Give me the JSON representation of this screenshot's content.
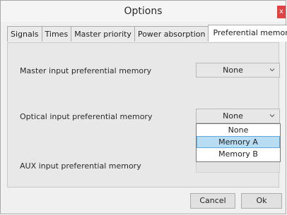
{
  "window": {
    "title": "Options",
    "close_glyph": "x"
  },
  "tabs": [
    {
      "label": "Signals",
      "active": false
    },
    {
      "label": "Times",
      "active": false
    },
    {
      "label": "Master priority",
      "active": false
    },
    {
      "label": "Power absorption",
      "active": false
    },
    {
      "label": "Preferential memory",
      "active": true
    }
  ],
  "settings": {
    "master": {
      "label": "Master input preferential memory",
      "value": "None"
    },
    "optical": {
      "label": "Optical input preferential memory",
      "value": "None"
    },
    "aux": {
      "label": "AUX input preferential memory",
      "value": ""
    }
  },
  "dropdown": {
    "options": [
      "None",
      "Memory A",
      "Memory B"
    ],
    "highlighted": "Memory A"
  },
  "buttons": {
    "cancel": "Cancel",
    "ok": "Ok"
  },
  "colors": {
    "close_button": "#e04343",
    "highlight_fill": "#b8dcf2",
    "highlight_border": "#5ea9dd"
  }
}
